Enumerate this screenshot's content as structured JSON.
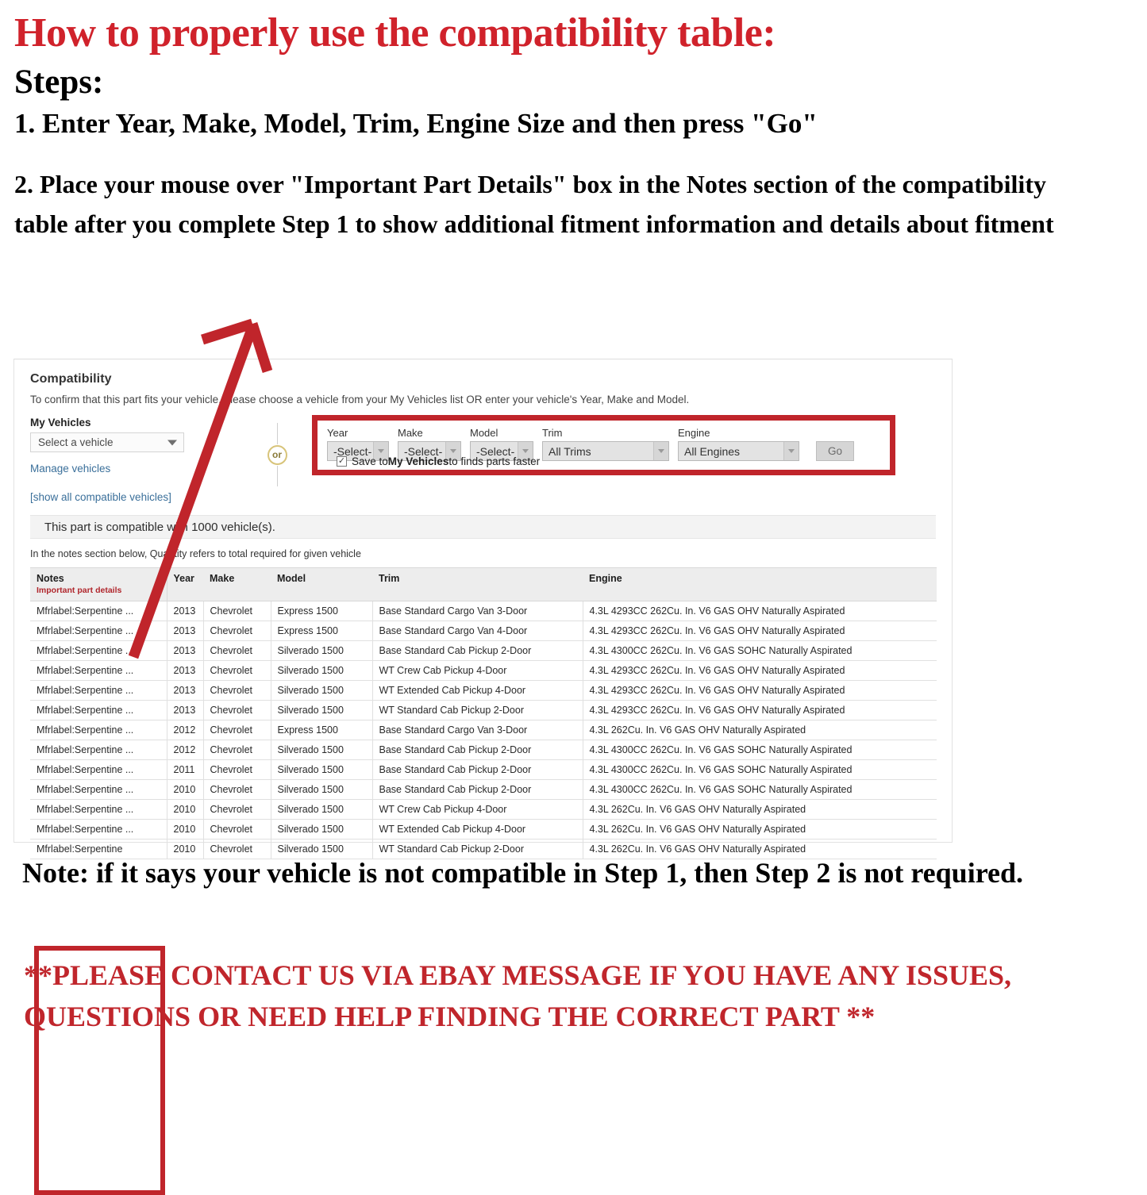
{
  "instructions": {
    "title": "How to properly use the compatibility table:",
    "steps_label": "Steps:",
    "step1": "1. Enter Year, Make, Model, Trim, Engine Size and then press \"Go\"",
    "step2": "2. Place your mouse over \"Important Part Details\" box in the Notes section of the compatibility table after you complete Step 1 to show additional fitment information and details about fitment"
  },
  "compatibility": {
    "heading": "Compatibility",
    "subheading": "To confirm that this part fits your vehicle, please choose a vehicle from your My Vehicles list OR enter your vehicle's Year, Make and Model.",
    "my_vehicles": {
      "label": "My Vehicles",
      "select_value": "Select a vehicle",
      "manage_link": "Manage vehicles"
    },
    "or_divider": "or",
    "finder": {
      "year": {
        "label": "Year",
        "value": "-Select-"
      },
      "make": {
        "label": "Make",
        "value": "-Select-"
      },
      "model": {
        "label": "Model",
        "value": "-Select-"
      },
      "trim": {
        "label": "Trim",
        "value": "All Trims"
      },
      "engine": {
        "label": "Engine",
        "value": "All Engines"
      },
      "go_button": "Go",
      "save_checkbox": {
        "checked": true,
        "check_glyph": "✓",
        "text_before": "Save to ",
        "text_bold": "My Vehicles",
        "text_after": " to finds parts faster"
      }
    },
    "show_all_link": "[show all compatible vehicles]",
    "compat_message": "This part is compatible with 1000 vehicle(s).",
    "quantity_note": "In the notes section below, Quantity refers to total required for given vehicle"
  },
  "table": {
    "columns": [
      "Notes",
      "Year",
      "Make",
      "Model",
      "Trim",
      "Engine"
    ],
    "notes_subheader": "Important part details",
    "rows": [
      {
        "notes": "Mfrlabel:Serpentine ...",
        "year": "2013",
        "make": "Chevrolet",
        "model": "Express 1500",
        "trim": "Base Standard Cargo Van 3-Door",
        "engine": "4.3L 4293CC 262Cu. In. V6 GAS OHV Naturally Aspirated"
      },
      {
        "notes": "Mfrlabel:Serpentine ...",
        "year": "2013",
        "make": "Chevrolet",
        "model": "Express 1500",
        "trim": "Base Standard Cargo Van 4-Door",
        "engine": "4.3L 4293CC 262Cu. In. V6 GAS OHV Naturally Aspirated"
      },
      {
        "notes": "Mfrlabel:Serpentine ...",
        "year": "2013",
        "make": "Chevrolet",
        "model": "Silverado 1500",
        "trim": "Base Standard Cab Pickup 2-Door",
        "engine": "4.3L 4300CC 262Cu. In. V6 GAS SOHC Naturally Aspirated"
      },
      {
        "notes": "Mfrlabel:Serpentine ...",
        "year": "2013",
        "make": "Chevrolet",
        "model": "Silverado 1500",
        "trim": "WT Crew Cab Pickup 4-Door",
        "engine": "4.3L 4293CC 262Cu. In. V6 GAS OHV Naturally Aspirated"
      },
      {
        "notes": "Mfrlabel:Serpentine ...",
        "year": "2013",
        "make": "Chevrolet",
        "model": "Silverado 1500",
        "trim": "WT Extended Cab Pickup 4-Door",
        "engine": "4.3L 4293CC 262Cu. In. V6 GAS OHV Naturally Aspirated"
      },
      {
        "notes": "Mfrlabel:Serpentine ...",
        "year": "2013",
        "make": "Chevrolet",
        "model": "Silverado 1500",
        "trim": "WT Standard Cab Pickup 2-Door",
        "engine": "4.3L 4293CC 262Cu. In. V6 GAS OHV Naturally Aspirated"
      },
      {
        "notes": "Mfrlabel:Serpentine ...",
        "year": "2012",
        "make": "Chevrolet",
        "model": "Express 1500",
        "trim": "Base Standard Cargo Van 3-Door",
        "engine": "4.3L 262Cu. In. V6 GAS OHV Naturally Aspirated"
      },
      {
        "notes": "Mfrlabel:Serpentine ...",
        "year": "2012",
        "make": "Chevrolet",
        "model": "Silverado 1500",
        "trim": "Base Standard Cab Pickup 2-Door",
        "engine": "4.3L 4300CC 262Cu. In. V6 GAS SOHC Naturally Aspirated"
      },
      {
        "notes": "Mfrlabel:Serpentine ...",
        "year": "2011",
        "make": "Chevrolet",
        "model": "Silverado 1500",
        "trim": "Base Standard Cab Pickup 2-Door",
        "engine": "4.3L 4300CC 262Cu. In. V6 GAS SOHC Naturally Aspirated"
      },
      {
        "notes": "Mfrlabel:Serpentine ...",
        "year": "2010",
        "make": "Chevrolet",
        "model": "Silverado 1500",
        "trim": "Base Standard Cab Pickup 2-Door",
        "engine": "4.3L 4300CC 262Cu. In. V6 GAS SOHC Naturally Aspirated"
      },
      {
        "notes": "Mfrlabel:Serpentine ...",
        "year": "2010",
        "make": "Chevrolet",
        "model": "Silverado 1500",
        "trim": "WT Crew Cab Pickup 4-Door",
        "engine": "4.3L 262Cu. In. V6 GAS OHV Naturally Aspirated"
      },
      {
        "notes": "Mfrlabel:Serpentine ...",
        "year": "2010",
        "make": "Chevrolet",
        "model": "Silverado 1500",
        "trim": "WT Extended Cab Pickup 4-Door",
        "engine": "4.3L 262Cu. In. V6 GAS OHV Naturally Aspirated"
      },
      {
        "notes": "Mfrlabel:Serpentine",
        "year": "2010",
        "make": "Chevrolet",
        "model": "Silverado 1500",
        "trim": "WT Standard Cab Pickup 2-Door",
        "engine": "4.3L 262Cu. In. V6 GAS OHV Naturally Aspirated"
      }
    ]
  },
  "footer": {
    "note": "Note: if it says your vehicle is not compatible in Step 1, then Step 2 is not required.",
    "contact": "**PLEASE CONTACT US VIA EBAY MESSAGE IF YOU HAVE ANY ISSUES, QUESTIONS OR NEED HELP FINDING THE CORRECT PART **"
  },
  "colors": {
    "headline_red": "#d0222b",
    "highlight_red": "#c0252b",
    "link_blue": "#3a6f9a",
    "notes_sub_red": "#b0262c"
  }
}
